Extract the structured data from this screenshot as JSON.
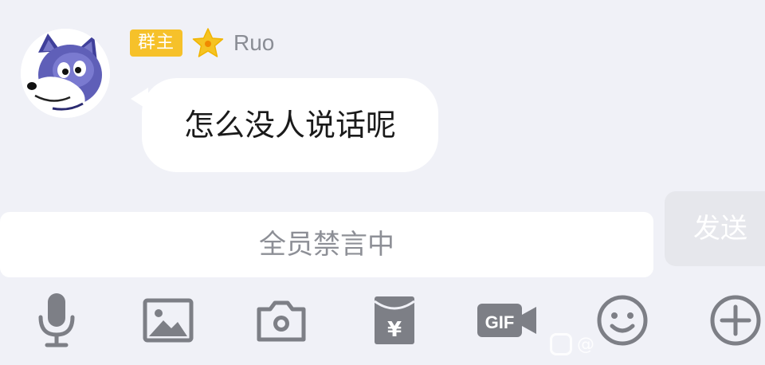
{
  "message": {
    "role_badge": "群主",
    "username": "Ruo",
    "text": "怎么没人说话呢"
  },
  "input": {
    "muted_text": "全员禁言中",
    "send_label": "发送"
  },
  "toolbar": {
    "icons": [
      "microphone-icon",
      "image-icon",
      "camera-icon",
      "red-packet-icon",
      "gif-icon",
      "emoji-icon",
      "plus-icon"
    ],
    "gif_label": "GIF"
  },
  "watermark": {
    "text": "@"
  },
  "colors": {
    "background": "#f0f1f7",
    "badge": "#f6c12a",
    "icon_gray": "#7d7f86",
    "star_yellow": "#f5c322"
  }
}
